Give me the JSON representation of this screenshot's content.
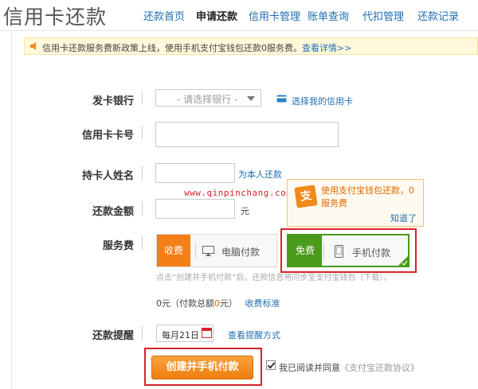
{
  "header": {
    "title": "信用卡还款",
    "nav": [
      "还款首页",
      "申请还款",
      "信用卡管理",
      "账单查询",
      "代扣管理",
      "还款记录"
    ],
    "active_nav": "申请还款"
  },
  "notice": {
    "text": "信用卡还款服务费新政策上线，使用手机支付宝钱包还款0服务费。",
    "link": "查看详情>>"
  },
  "form": {
    "bank_label": "发卡银行",
    "bank_select_placeholder": "- 请选择银行 -",
    "my_cards_link": "选择我的信用卡",
    "card_number_label": "信用卡卡号",
    "card_number_value": "",
    "holder_label": "持卡人姓名",
    "holder_value": "",
    "self_repay_link": "为本人还款",
    "amount_label": "还款金额",
    "amount_value": "",
    "amount_unit": "元",
    "fee_label": "服务费",
    "fee_options": [
      {
        "tag": "收费",
        "label": "电脑付款",
        "tag_color": "#f57f17"
      },
      {
        "tag": "免费",
        "label": "手机付款",
        "tag_color": "#4a9a1c"
      }
    ],
    "hint": "点击“创建并手机付款”后，还款信息将同步至支付宝钱包（下载）。",
    "total_prefix": "0元（付款总额",
    "total_amount": "0",
    "total_suffix": "元）",
    "fee_standard_link": "收费标准",
    "reminder_label": "还款提醒",
    "reminder_date": "每月21日",
    "reminder_link": "查看提醒方式",
    "submit_label": "创建并手机付款",
    "agree_text": "我已阅读并同意",
    "agree_link": "《支付宝还款协议》"
  },
  "popup": {
    "icon_text": "支",
    "text": "使用支付宝钱包还款，0服务费",
    "ok": "知道了"
  },
  "watermark": "www.qinpinchang.com",
  "colors": {
    "accent_orange": "#f57f17",
    "accent_green": "#4a9a1c",
    "highlight_red": "#d8232a",
    "link_blue": "#1f6fb2"
  }
}
